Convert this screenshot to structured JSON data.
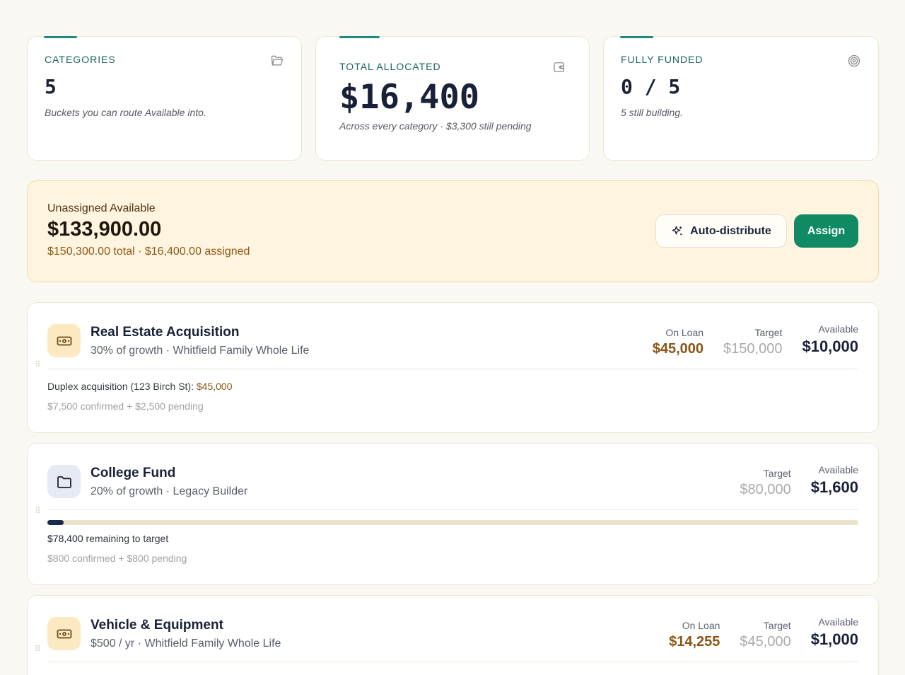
{
  "stats": [
    {
      "label": "CATEGORIES",
      "value": "5",
      "note": "Buckets you can route Available into.",
      "icon": "folder-open-icon"
    },
    {
      "label": "TOTAL ALLOCATED",
      "value": "$16,400",
      "note": "Across every category · $3,300 still pending",
      "icon": "wallet-icon"
    },
    {
      "label": "FULLY FUNDED",
      "value": "0 / 5",
      "note": "5 still building.",
      "icon": "target-icon"
    }
  ],
  "unassigned": {
    "label": "Unassigned Available",
    "amount": "$133,900.00",
    "summary": "$150,300.00 total · $16,400.00 assigned",
    "auto_label": "Auto-distribute",
    "assign_label": "Assign"
  },
  "categories": [
    {
      "title": "Real Estate Acquisition",
      "subtitle": "30% of growth · Whitfield Family Whole Life",
      "icon": "cash-icon",
      "on_loan_label": "On Loan",
      "on_loan": "$45,000",
      "target_label": "Target",
      "target": "$150,000",
      "available_label": "Available",
      "available": "$10,000",
      "detail_text": "Duplex acquisition (123 Birch St): ",
      "detail_amount": "$45,000",
      "pending": "$7,500 confirmed + $2,500 pending"
    },
    {
      "title": "College Fund",
      "subtitle": "20% of growth · Legacy Builder",
      "icon": "folder-icon",
      "target_label": "Target",
      "target": "$80,000",
      "available_label": "Available",
      "available": "$1,600",
      "progress_fraction": 0.02,
      "remaining_amount": "$78,400",
      "remaining_text": " remaining to target",
      "pending": "$800 confirmed + $800 pending"
    },
    {
      "title": "Vehicle & Equipment",
      "subtitle": "$500 / yr · Whitfield Family Whole Life",
      "icon": "cash-icon",
      "on_loan_label": "On Loan",
      "on_loan": "$14,255",
      "target_label": "Target",
      "target": "$45,000",
      "available_label": "Available",
      "available": "$1,000"
    }
  ],
  "colors": {
    "accent": "#0f8a64",
    "teal": "#17665c",
    "loan": "#8a5514",
    "banner": "#fff4df"
  }
}
